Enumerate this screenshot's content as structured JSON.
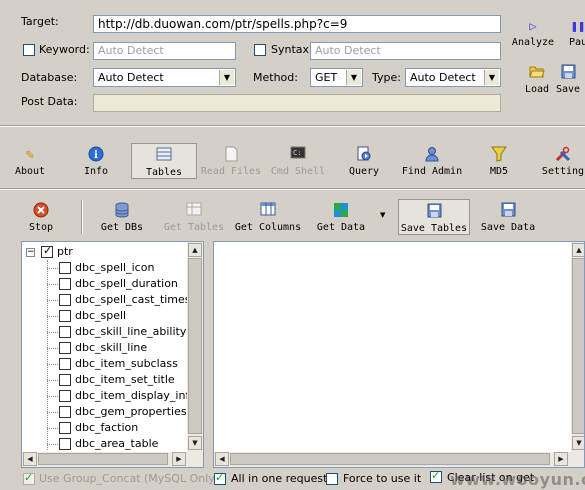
{
  "form": {
    "target_label": "Target:",
    "target_value": "http://db.duowan.com/ptr/spells.php?c=9",
    "keyword_label": "Keyword:",
    "keyword_value": "Auto Detect",
    "syntax_label": "Syntax:",
    "syntax_value": "Auto Detect",
    "database_label": "Database:",
    "database_value": "Auto Detect",
    "method_label": "Method:",
    "method_value": "GET",
    "type_label": "Type:",
    "type_value": "Auto Detect",
    "postdata_label": "Post Data:"
  },
  "side_actions": {
    "analyze": "Analyze",
    "pause": "Pau",
    "load": "Load",
    "save": "Save"
  },
  "main_toolbar": {
    "about": "About",
    "info": "Info",
    "tables": "Tables",
    "read_files": "Read Files",
    "cmd_shell": "Cmd Shell",
    "query": "Query",
    "find_admin": "Find Admin",
    "md5": "MD5",
    "settings": "Setting"
  },
  "sub_toolbar": {
    "stop": "Stop",
    "get_dbs": "Get DBs",
    "get_tables": "Get Tables",
    "get_columns": "Get Columns",
    "get_data": "Get Data",
    "save_tables": "Save Tables",
    "save_data": "Save Data"
  },
  "tree": {
    "root": "ptr",
    "items": [
      "dbc_spell_icon",
      "dbc_spell_duration",
      "dbc_spell_cast_times",
      "dbc_spell",
      "dbc_skill_line_ability",
      "dbc_skill_line",
      "dbc_item_subclass",
      "dbc_item_set_title",
      "dbc_item_display_info",
      "dbc_gem_properties",
      "dbc_faction",
      "dbc_area_table"
    ]
  },
  "bottom": {
    "group_concat": "Use Group_Concat (MySQL Only)",
    "all_in_one": "All in one request.",
    "force_use": "Force to use it",
    "clear_list": "Clear list on get"
  },
  "watermark": "www.wooyun.org"
}
